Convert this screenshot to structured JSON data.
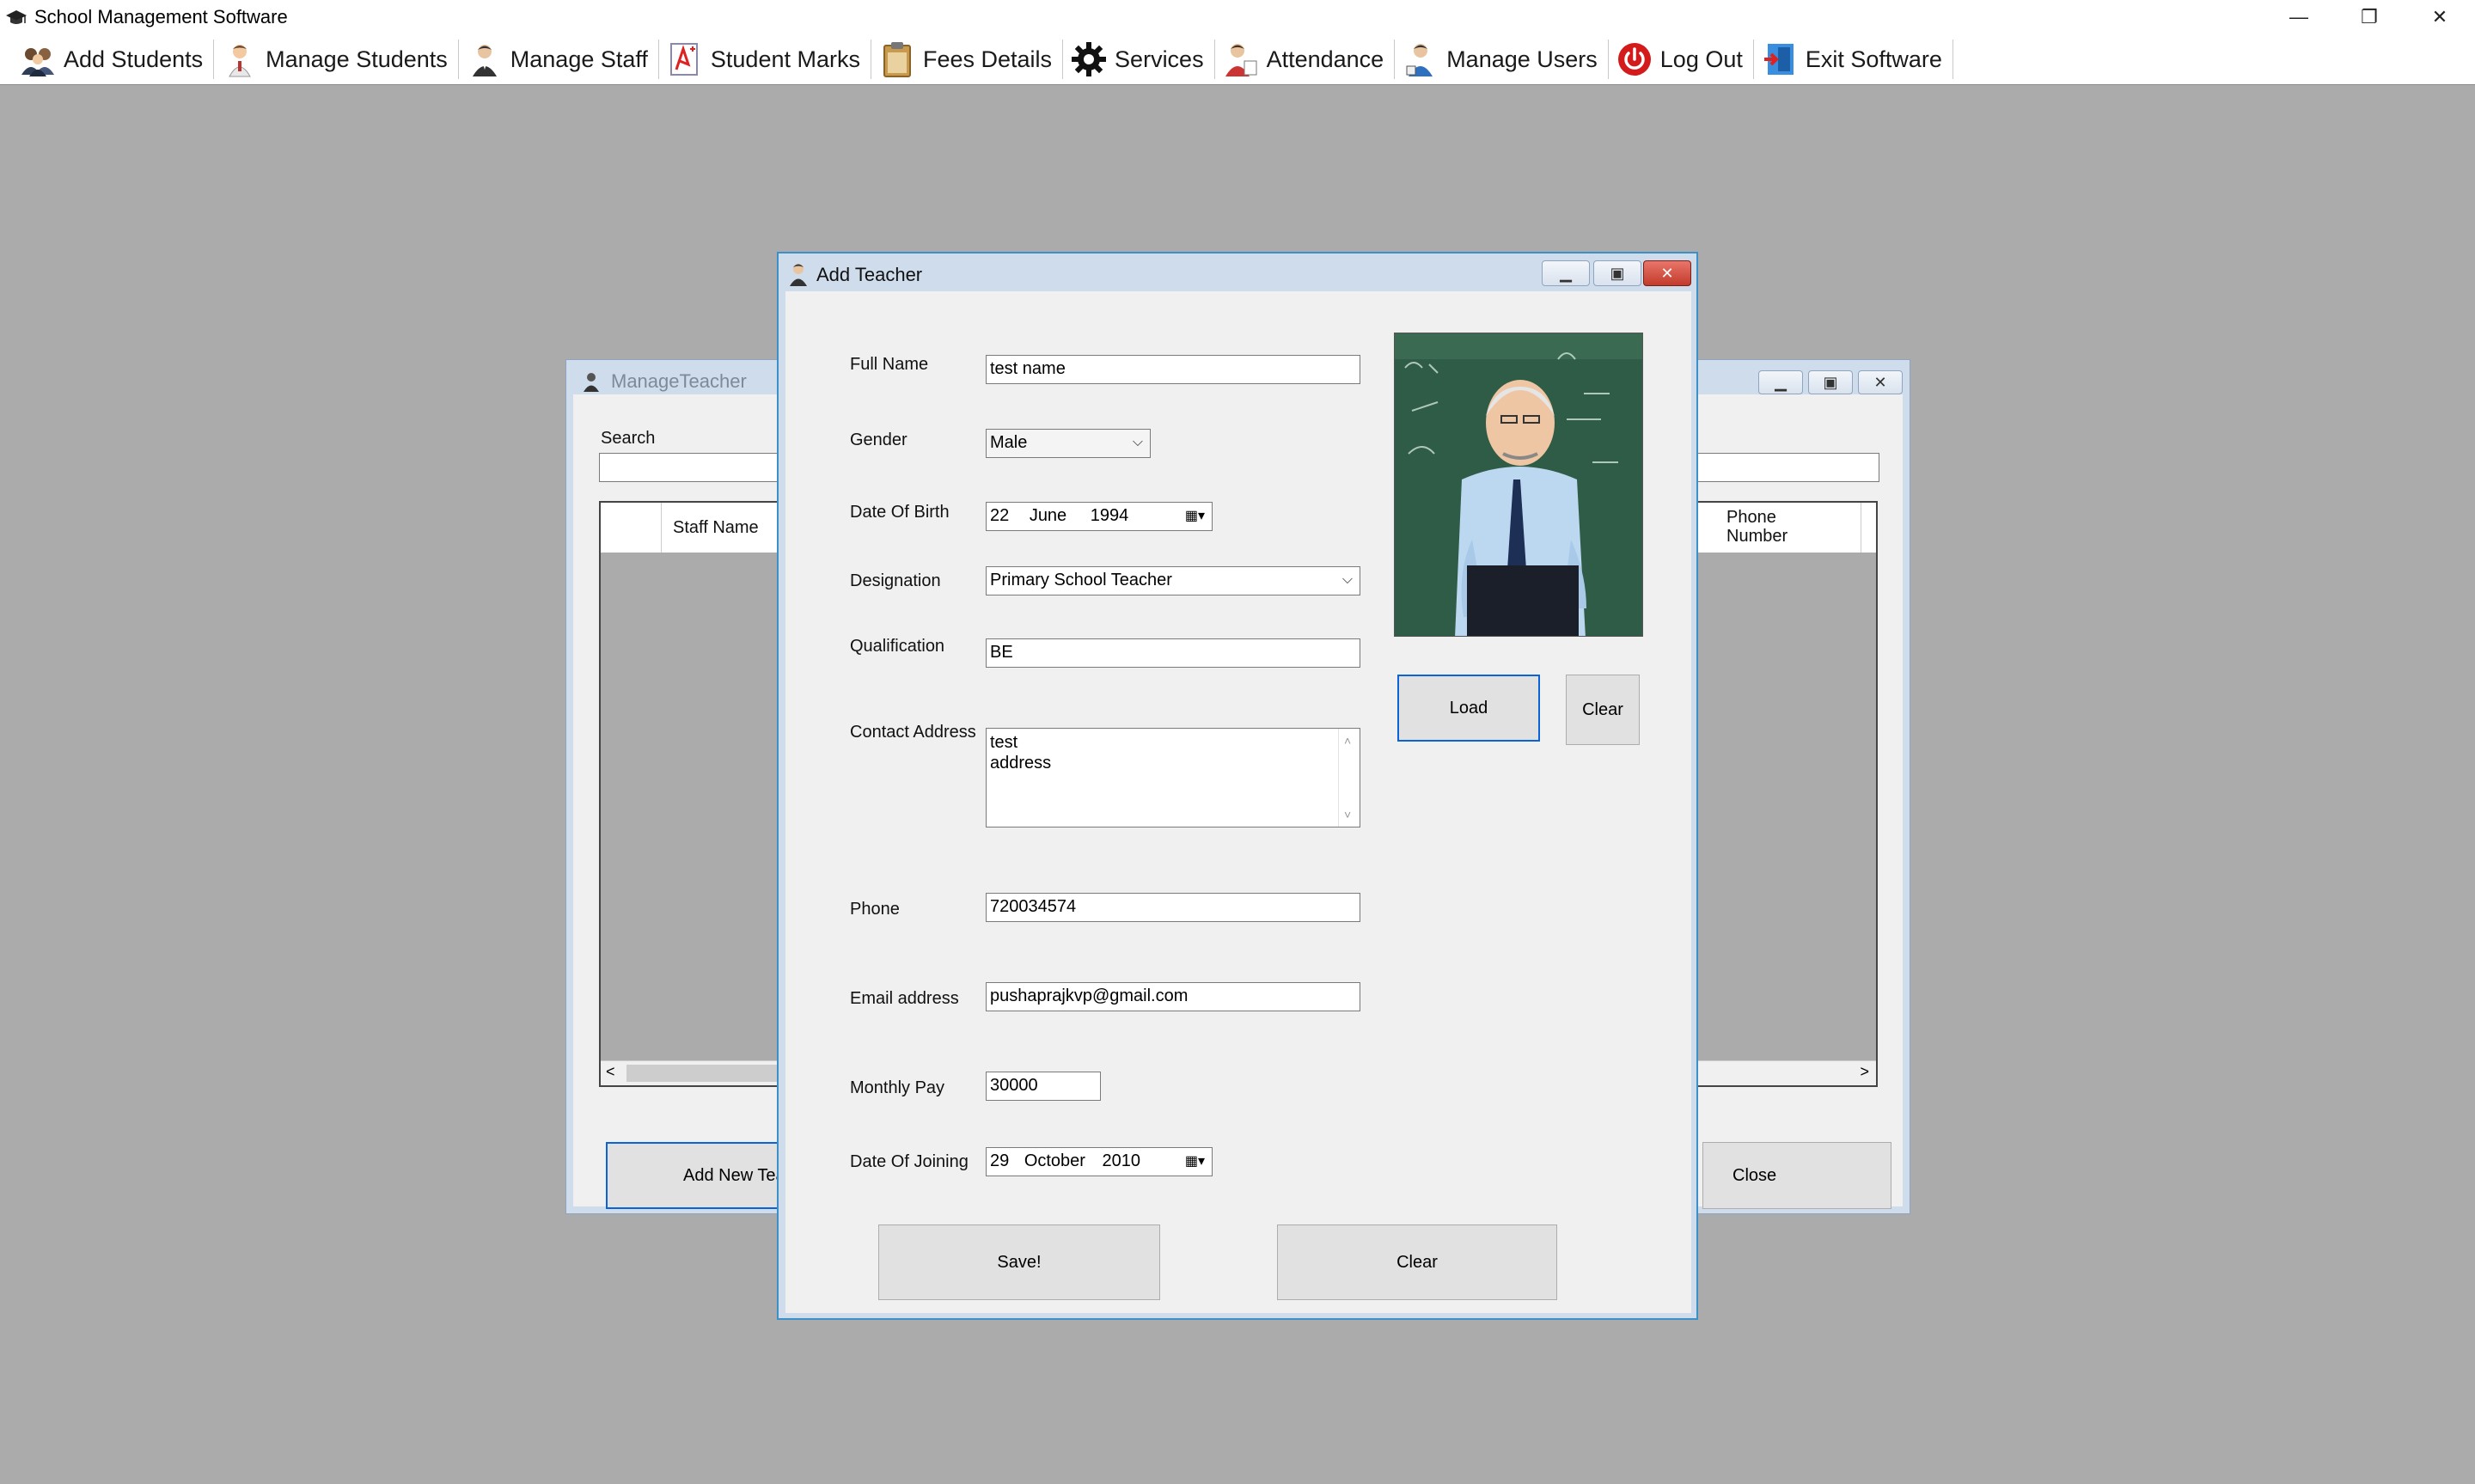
{
  "app": {
    "title": "School Management Software",
    "window_controls": {
      "minimize": "—",
      "restore": "❐",
      "close": "✕"
    }
  },
  "toolbar": {
    "items": [
      {
        "label": "Add Students",
        "icon": "students-group-icon"
      },
      {
        "label": "Manage Students",
        "icon": "student-person-icon"
      },
      {
        "label": "Manage Staff",
        "icon": "staff-person-icon"
      },
      {
        "label": "Student Marks",
        "icon": "marks-sheet-icon"
      },
      {
        "label": "Fees Details",
        "icon": "clipboard-icon"
      },
      {
        "label": "Services",
        "icon": "gear-icon"
      },
      {
        "label": "Attendance",
        "icon": "attendance-person-icon"
      },
      {
        "label": "Manage Users",
        "icon": "users-icon"
      },
      {
        "label": "Log Out",
        "icon": "power-icon"
      },
      {
        "label": "Exit Software",
        "icon": "exit-door-icon"
      }
    ]
  },
  "manage_teacher": {
    "title": "ManageTeacher",
    "search_label": "Search",
    "search_value": "",
    "columns": {
      "staff_name": "Staff Name",
      "phone_number": "Phone Number"
    },
    "add_button": "Add New Tea",
    "close_button": "Close"
  },
  "add_teacher": {
    "title": "Add Teacher",
    "fields": {
      "full_name": {
        "label": "Full Name",
        "value": "test name"
      },
      "gender": {
        "label": "Gender",
        "value": "Male"
      },
      "dob": {
        "label": "Date Of Birth",
        "day": "22",
        "month": "June",
        "year": "1994"
      },
      "designation": {
        "label": "Designation",
        "value": "Primary School Teacher"
      },
      "qualification": {
        "label": "Qualification",
        "value": "BE"
      },
      "contact_address": {
        "label": "Contact Address",
        "line1": "test",
        "line2": "address"
      },
      "phone": {
        "label": "Phone",
        "value": "720034574"
      },
      "email": {
        "label": "Email address",
        "value": "pushaprajkvp@gmail.com"
      },
      "monthly_pay": {
        "label": "Monthly Pay",
        "value": "30000"
      },
      "doj": {
        "label": "Date Of Joining",
        "day": "29",
        "month": "October",
        "year": "2010"
      }
    },
    "photo_buttons": {
      "load": "Load",
      "clear": "Clear"
    },
    "save_button": "Save!",
    "clear_button": "Clear"
  }
}
